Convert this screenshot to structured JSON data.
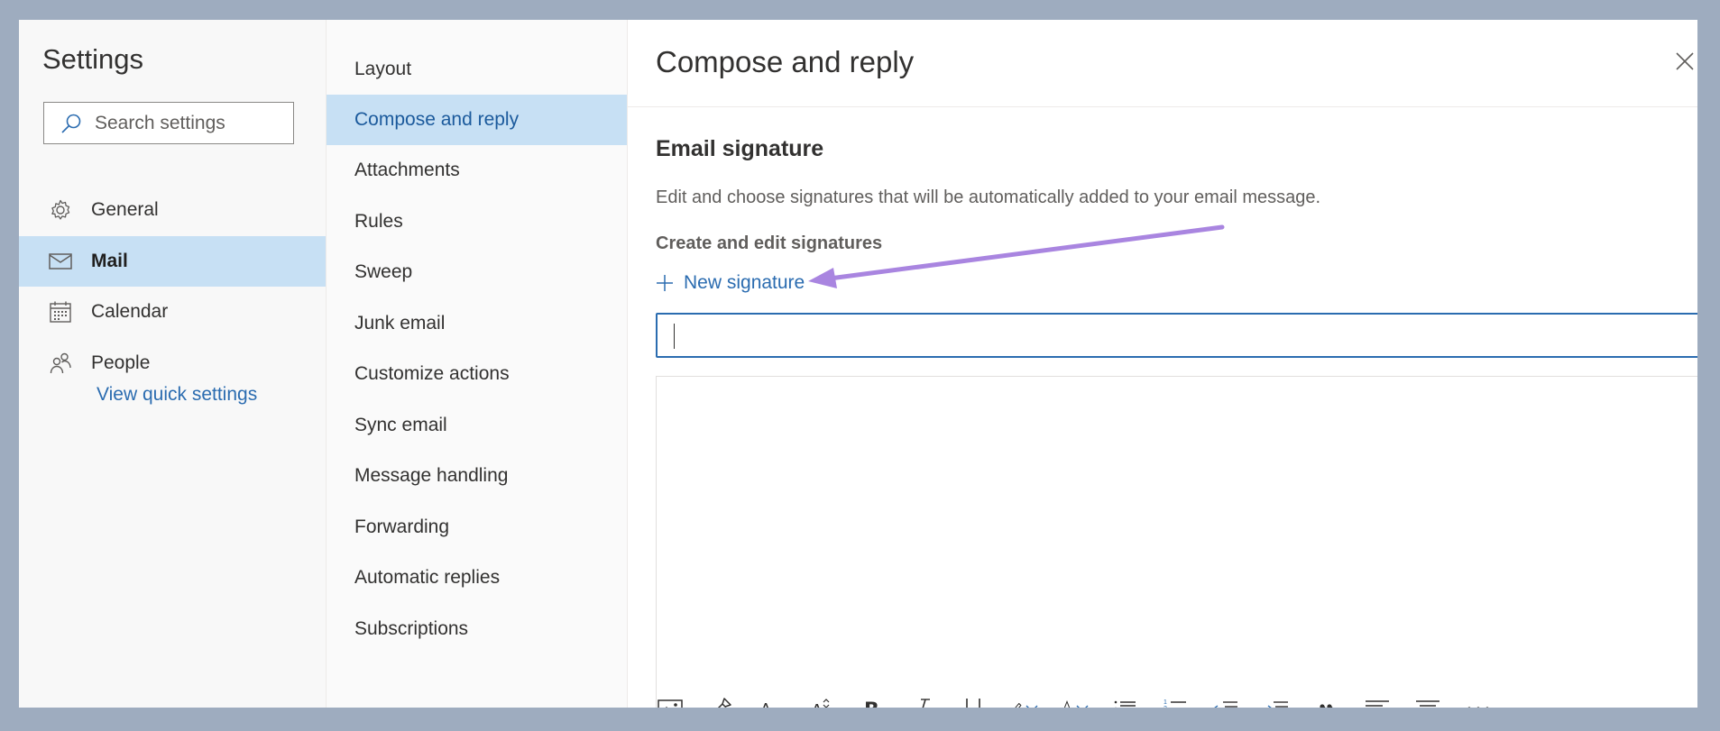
{
  "left_nav": {
    "title": "Settings",
    "search_placeholder": "Search settings",
    "items": [
      {
        "label": "General",
        "icon": "gear-icon",
        "selected": false
      },
      {
        "label": "Mail",
        "icon": "mail-icon",
        "selected": true
      },
      {
        "label": "Calendar",
        "icon": "calendar-icon",
        "selected": false
      },
      {
        "label": "People",
        "icon": "people-icon",
        "selected": false
      }
    ],
    "quick_settings_link": "View quick settings"
  },
  "sub_nav": {
    "items": [
      {
        "label": "Layout",
        "selected": false
      },
      {
        "label": "Compose and reply",
        "selected": true
      },
      {
        "label": "Attachments",
        "selected": false
      },
      {
        "label": "Rules",
        "selected": false
      },
      {
        "label": "Sweep",
        "selected": false
      },
      {
        "label": "Junk email",
        "selected": false
      },
      {
        "label": "Customize actions",
        "selected": false
      },
      {
        "label": "Sync email",
        "selected": false
      },
      {
        "label": "Message handling",
        "selected": false
      },
      {
        "label": "Forwarding",
        "selected": false
      },
      {
        "label": "Automatic replies",
        "selected": false
      },
      {
        "label": "Subscriptions",
        "selected": false
      }
    ]
  },
  "main": {
    "title": "Compose and reply",
    "section_title": "Email signature",
    "section_description": "Edit and choose signatures that will be automatically added to your email message.",
    "subheading": "Create and edit signatures",
    "new_signature_label": "New signature",
    "signature_name_value": "",
    "toolbar_icons": [
      "insert-picture-icon",
      "format-painter-icon",
      "font-size-icon",
      "grow-font-icon",
      "bold-icon",
      "italic-icon",
      "underline-icon",
      "highlight-icon",
      "font-color-icon",
      "bullets-icon",
      "numbering-icon",
      "decrease-indent-icon",
      "increase-indent-icon",
      "quote-icon",
      "align-left-icon",
      "align-center-icon",
      "more-options-icon"
    ]
  },
  "colors": {
    "background": "#9eacbf",
    "selected_nav": "#c7e0f4",
    "accent": "#2b6cb0",
    "annotation_arrow": "#a985e0"
  }
}
